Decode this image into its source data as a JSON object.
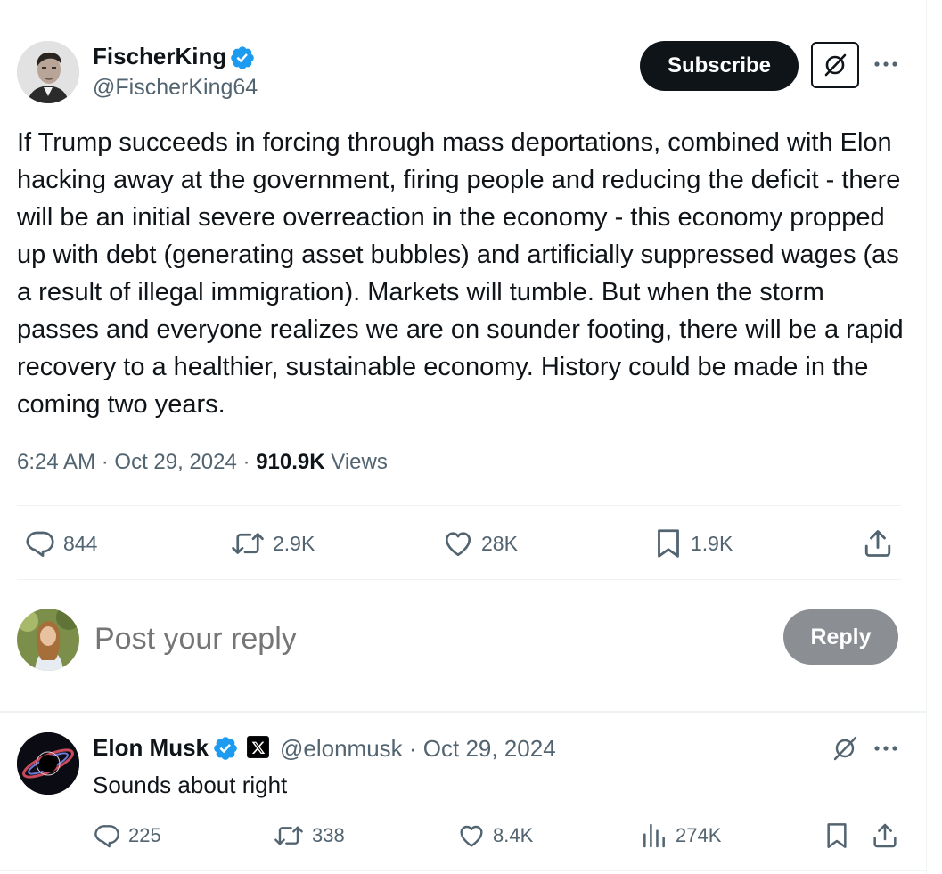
{
  "post": {
    "author_name": "FischerKing",
    "author_handle": "@FischerKing64",
    "subscribe_label": "Subscribe",
    "body": "If Trump succeeds in forcing through mass deportations, combined with Elon hacking away at the government, firing people and reducing the deficit - there will be an initial severe overreaction in the economy - this economy propped up with debt (generating asset bubbles) and artificially suppressed wages (as a result of illegal immigration). Markets will tumble. But when the storm passes and everyone realizes we are on sounder footing, there will be a rapid recovery to a healthier, sustainable economy. History could be made in the coming two years.",
    "time": "6:24 AM",
    "date": "Oct 29, 2024",
    "views_count": "910.9K",
    "views_label": "Views",
    "stats": {
      "replies": "844",
      "reposts": "2.9K",
      "likes": "28K",
      "bookmarks": "1.9K"
    }
  },
  "composer": {
    "placeholder": "Post your reply",
    "reply_label": "Reply"
  },
  "reply": {
    "author_name": "Elon Musk",
    "handle_and_date": "@elonmusk · Oct 29, 2024",
    "text": "Sounds about right",
    "stats": {
      "replies": "225",
      "reposts": "338",
      "likes": "8.4K",
      "views": "274K"
    }
  },
  "icons": {
    "verified": "verified-badge-icon",
    "grok": "grok-icon",
    "more": "more-icon",
    "reply": "reply-icon",
    "repost": "repost-icon",
    "like": "heart-icon",
    "bookmark": "bookmark-icon",
    "share": "share-icon",
    "views": "views-icon",
    "x_logo": "x-logo-icon"
  },
  "colors": {
    "text_primary": "#0f1419",
    "text_secondary": "#536471",
    "verified_blue": "#1d9bf0",
    "reply_button_disabled": "#8b8f94",
    "divider": "#eff3f4"
  }
}
